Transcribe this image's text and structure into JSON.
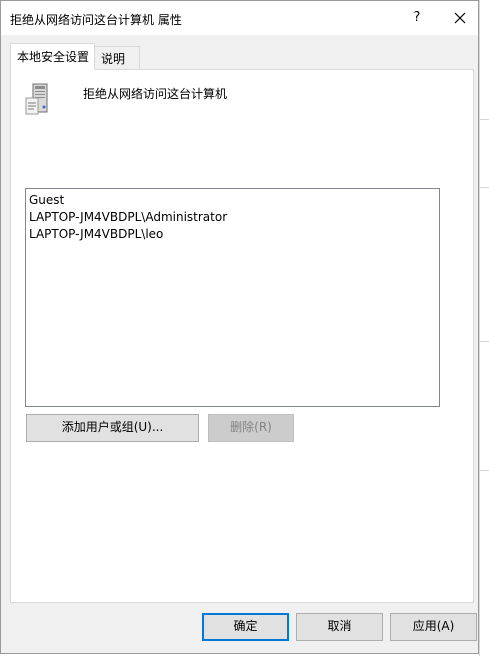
{
  "window": {
    "title": "拒绝从网络访问这台计算机 属性",
    "help_label": "?",
    "close_icon": "close-icon"
  },
  "tabs": [
    {
      "label": "本地安全设置",
      "active": true
    },
    {
      "label": "说明",
      "active": false
    }
  ],
  "policy": {
    "icon": "server-policy-icon",
    "name": "拒绝从网络访问这台计算机"
  },
  "accounts": [
    "Guest",
    "LAPTOP-JM4VBDPL\\Administrator",
    "LAPTOP-JM4VBDPL\\leo"
  ],
  "actions": {
    "add_label": "添加用户或组(U)...",
    "remove_label": "删除(R)"
  },
  "footer": {
    "ok_label": "确定",
    "cancel_label": "取消",
    "apply_label": "应用(A)"
  },
  "colors": {
    "focus_border": "#0078d7",
    "dialog_bg": "#f0f0f0"
  }
}
